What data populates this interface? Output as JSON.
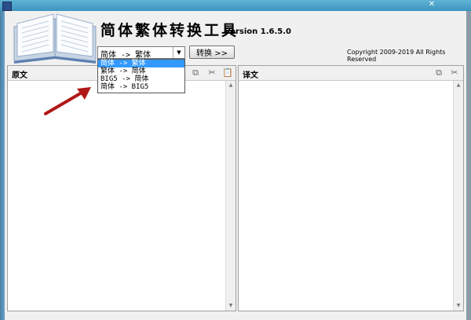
{
  "window": {
    "close_glyph": "✕"
  },
  "app": {
    "title": "简体繁体转换工具",
    "version": "Version 1.6.5.0",
    "copyright": "Copyright 2009-2019 All Rights Reserved"
  },
  "toolbar": {
    "mode_selected": "简体 -> 繁体",
    "convert_label": "转换 >>",
    "mode_options": [
      "简体 -> 繁体",
      "繁体 -> 简体",
      "BIG5 -> 简体",
      "简体 -> BIG5"
    ]
  },
  "source_panel": {
    "label": "原文",
    "icons": [
      "copy-icon",
      "cut-icon",
      "paste-icon"
    ]
  },
  "target_panel": {
    "label": "译文",
    "icons": [
      "copy-icon",
      "cut-icon"
    ]
  },
  "colors": {
    "titlebar": "#3d94bf",
    "selection": "#3399ff",
    "arrow": "#b01818"
  }
}
